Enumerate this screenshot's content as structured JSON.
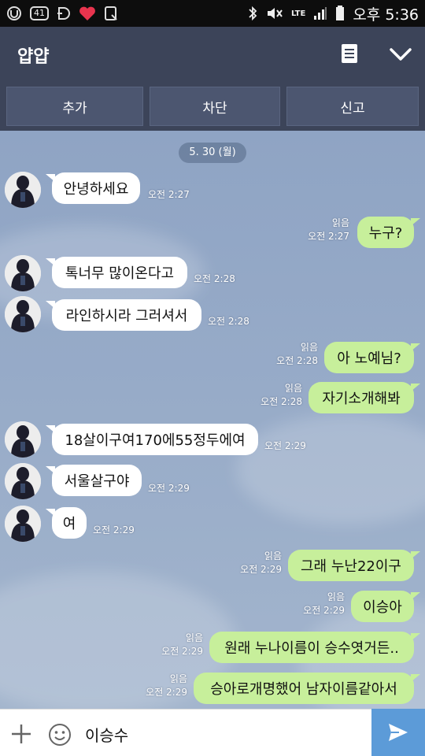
{
  "status_bar": {
    "icons": [
      "app-icon",
      "notification-count-icon",
      "d-icon",
      "heart-icon",
      "clipboard-icon"
    ],
    "badge": "41",
    "network": "LTE",
    "time": "오후 5:36"
  },
  "header": {
    "title": "얍얍",
    "menu_icon": "menu-icon",
    "collapse_icon": "chevron-down-icon"
  },
  "actions": {
    "add": "추가",
    "block": "차단",
    "report": "신고"
  },
  "date_divider": "5. 30 (월)",
  "messages": [
    {
      "dir": "in",
      "text": "안녕하세요",
      "time": "오전 2:27",
      "avatar": true
    },
    {
      "dir": "out",
      "text": "누구?",
      "time": "오전 2:27",
      "read": "읽음"
    },
    {
      "dir": "in",
      "text": "톡너무 많이온다고",
      "time": "오전 2:28",
      "avatar": true
    },
    {
      "dir": "in",
      "text": "라인하시라 그러셔서",
      "time": "오전 2:28",
      "avatar": true
    },
    {
      "dir": "out",
      "text": "아 노예님?",
      "time": "오전 2:28",
      "read": "읽음"
    },
    {
      "dir": "out",
      "text": "자기소개해봐",
      "time": "오전 2:28",
      "read": "읽음"
    },
    {
      "dir": "in",
      "text": "18살이구여170에55정두에여",
      "time": "오전 2:29",
      "avatar": true
    },
    {
      "dir": "in",
      "text": "서울살구야",
      "time": "오전 2:29",
      "avatar": true
    },
    {
      "dir": "in",
      "text": "여",
      "time": "오전 2:29",
      "avatar": true
    },
    {
      "dir": "out",
      "text": "그래 누난22이구",
      "time": "오전 2:29",
      "read": "읽음"
    },
    {
      "dir": "out",
      "text": "이승아",
      "time": "오전 2:29",
      "read": "읽음"
    },
    {
      "dir": "out",
      "text": "원래 누나이름이 승수엿거든..",
      "time": "오전 2:29",
      "read": "읽음"
    },
    {
      "dir": "out",
      "text": "승아로개명했어 남자이름같아서",
      "time": "오전 2:29",
      "read": "읽음"
    }
  ],
  "input": {
    "value": "이승수"
  },
  "colors": {
    "header": "#3c4459",
    "chat_bg": "#8fa4c4",
    "out_bubble": "#c7ef9b",
    "in_bubble": "#ffffff",
    "send": "#5c9bd8"
  }
}
